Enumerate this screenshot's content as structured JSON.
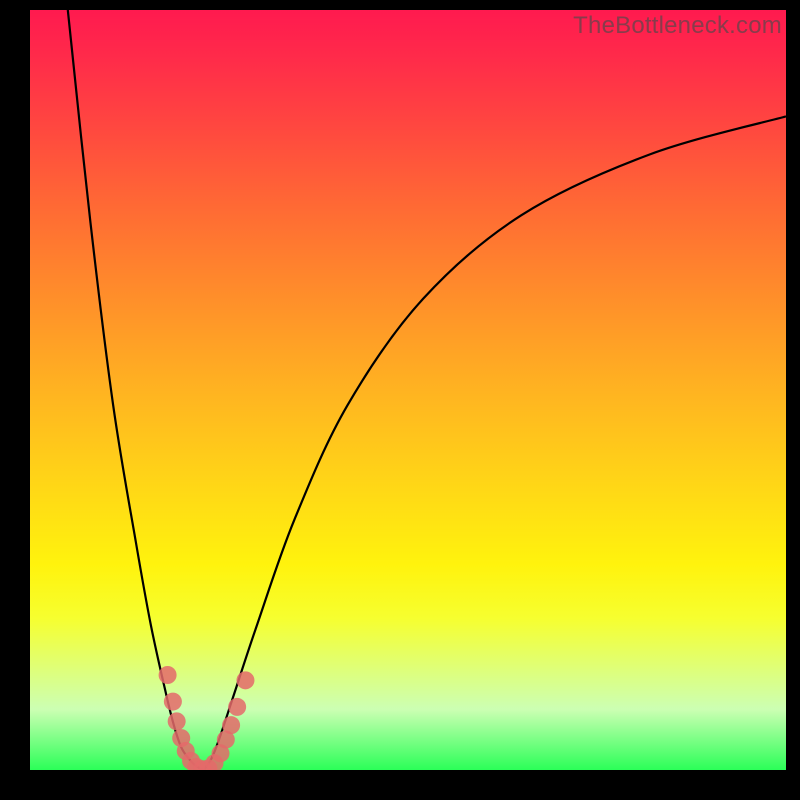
{
  "watermark": "TheBottleneck.com",
  "chart_data": {
    "type": "line",
    "title": "",
    "xlabel": "",
    "ylabel": "",
    "xlim": [
      0,
      100
    ],
    "ylim": [
      0,
      100
    ],
    "grid": false,
    "legend": false,
    "series": [
      {
        "name": "left-branch",
        "x": [
          5,
          8,
          11,
          14,
          16,
          18,
          19,
          20,
          21,
          22,
          23
        ],
        "y": [
          100,
          72,
          48,
          30,
          19,
          10,
          6,
          3,
          1.5,
          0.5,
          0
        ]
      },
      {
        "name": "right-branch",
        "x": [
          23,
          24,
          25,
          27,
          30,
          35,
          42,
          52,
          65,
          82,
          100
        ],
        "y": [
          0,
          1.5,
          4,
          10,
          19,
          33,
          48,
          62,
          73,
          81,
          86
        ]
      }
    ],
    "markers": [
      {
        "x": 18.2,
        "y": 12.5
      },
      {
        "x": 18.9,
        "y": 9.0
      },
      {
        "x": 19.4,
        "y": 6.4
      },
      {
        "x": 20.0,
        "y": 4.2
      },
      {
        "x": 20.6,
        "y": 2.5
      },
      {
        "x": 21.3,
        "y": 1.2
      },
      {
        "x": 22.0,
        "y": 0.4
      },
      {
        "x": 22.8,
        "y": 0.1
      },
      {
        "x": 23.6,
        "y": 0.2
      },
      {
        "x": 24.4,
        "y": 0.9
      },
      {
        "x": 25.2,
        "y": 2.2
      },
      {
        "x": 25.9,
        "y": 4.0
      },
      {
        "x": 26.6,
        "y": 5.9
      },
      {
        "x": 27.4,
        "y": 8.3
      },
      {
        "x": 28.5,
        "y": 11.8
      }
    ],
    "marker_color": "#e46a6a",
    "marker_radius_px": 9,
    "background_gradient": {
      "top": "#ff1a4f",
      "bottom": "#2bff58"
    }
  }
}
